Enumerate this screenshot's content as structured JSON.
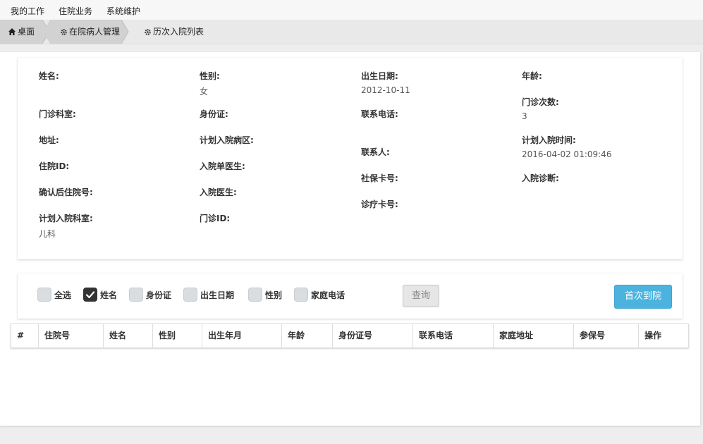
{
  "top_menu": {
    "items": [
      "我的工作",
      "住院业务",
      "系统维护"
    ]
  },
  "breadcrumb": {
    "home": "桌面",
    "section": "在院病人管理",
    "current": "历次入院列表"
  },
  "patient_info": {
    "col1": [
      {
        "label": "姓名:",
        "value": ""
      },
      {
        "label": "门诊科室:",
        "value": ""
      },
      {
        "label": "地址:",
        "value": ""
      },
      {
        "label": "住院ID:",
        "value": ""
      },
      {
        "label": "确认后住院号:",
        "value": ""
      },
      {
        "label": "计划入院科室:",
        "value": "儿科"
      }
    ],
    "col2": [
      {
        "label": "性别:",
        "value": "女"
      },
      {
        "label": "身份证:",
        "value": ""
      },
      {
        "label": "计划入院病区:",
        "value": ""
      },
      {
        "label": "入院单医生:",
        "value": ""
      },
      {
        "label": "入院医生:",
        "value": ""
      },
      {
        "label": "门诊ID:",
        "value": ""
      }
    ],
    "col3": [
      {
        "label": "出生日期:",
        "value": "2012-10-11"
      },
      {
        "label": "联系电话:",
        "value": ""
      },
      {
        "label": "联系人:",
        "value": ""
      },
      {
        "label": "社保卡号:",
        "value": ""
      },
      {
        "label": "诊疗卡号:",
        "value": ""
      }
    ],
    "col4": [
      {
        "label": "年龄:",
        "value": ""
      },
      {
        "label": "门诊次数:",
        "value": "3"
      },
      {
        "label": "计划入院时间:",
        "value": "2016-04-02 01:09:46"
      },
      {
        "label": "入院诊断:",
        "value": ""
      }
    ]
  },
  "filters": {
    "items": [
      {
        "label": "全选",
        "checked": false
      },
      {
        "label": "姓名",
        "checked": true
      },
      {
        "label": "身份证",
        "checked": false
      },
      {
        "label": "出生日期",
        "checked": false
      },
      {
        "label": "性别",
        "checked": false
      },
      {
        "label": "家庭电话",
        "checked": false
      }
    ],
    "query_label": "查询",
    "first_visit_label": "首次到院"
  },
  "table": {
    "headers": [
      "#",
      "住院号",
      "姓名",
      "性别",
      "出生年月",
      "年龄",
      "身份证号",
      "联系电话",
      "家庭地址",
      "参保号",
      "操作"
    ]
  },
  "colors": {
    "primary_button": "#4cb3df",
    "checked_box": "#333333"
  }
}
